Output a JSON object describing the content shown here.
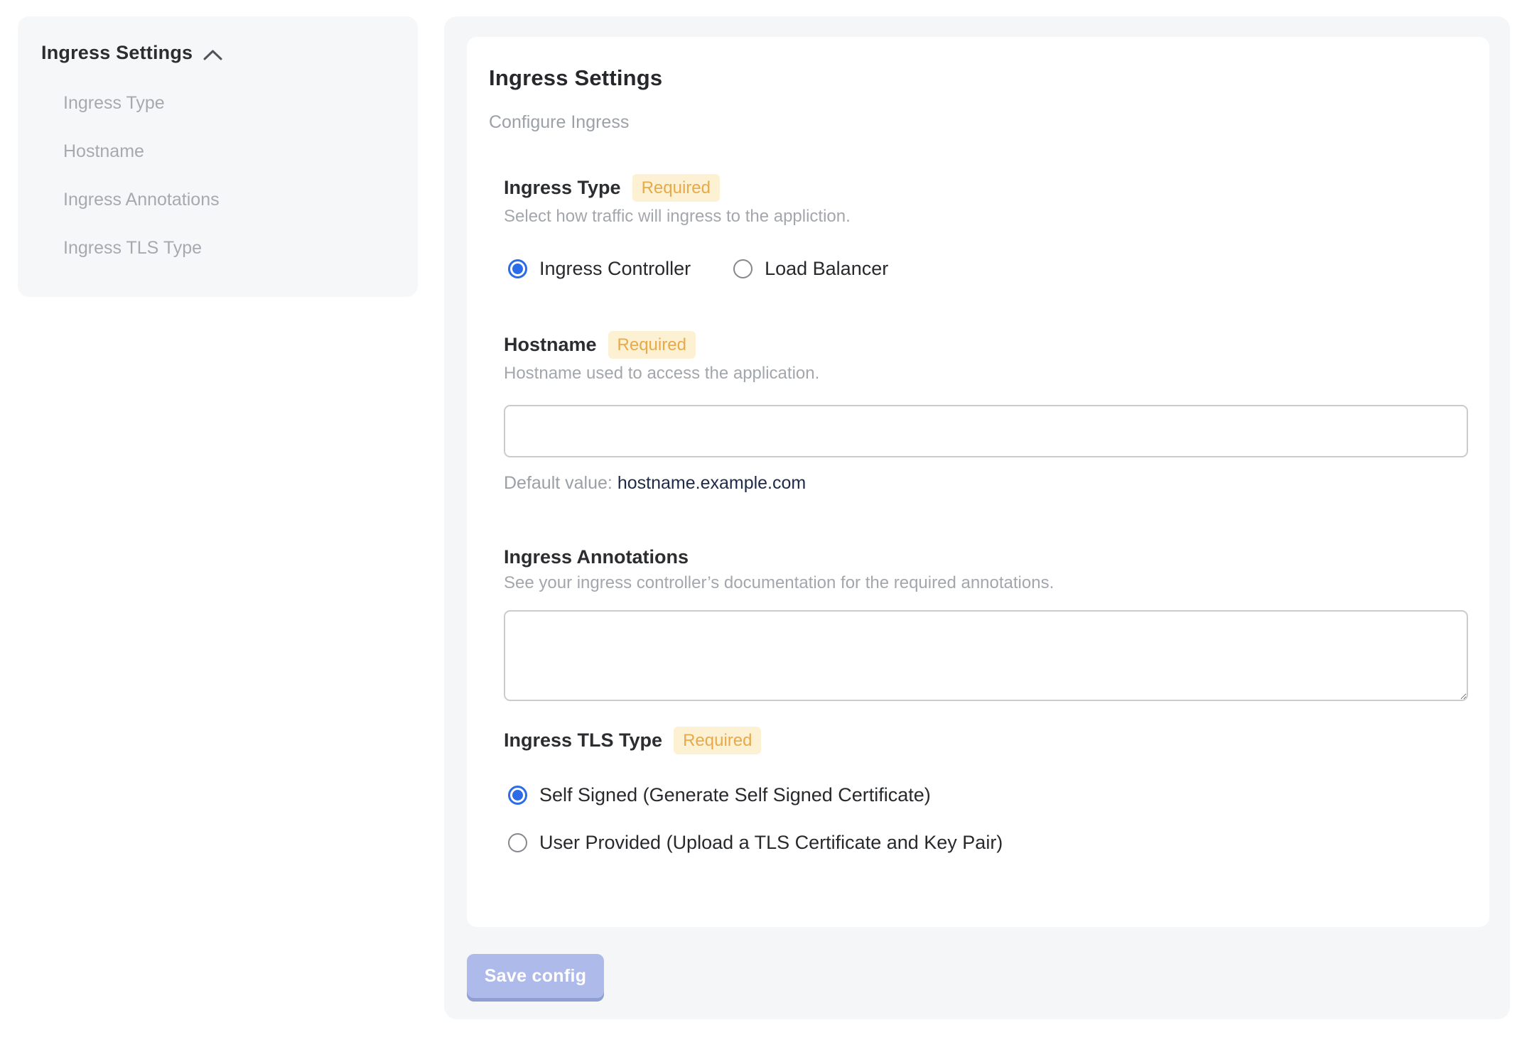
{
  "sidebar": {
    "title": "Ingress Settings",
    "collapse_icon": "chevron-up-icon",
    "items": [
      {
        "label": "Ingress Type"
      },
      {
        "label": "Hostname"
      },
      {
        "label": "Ingress Annotations"
      },
      {
        "label": "Ingress TLS Type"
      }
    ]
  },
  "main": {
    "title": "Ingress Settings",
    "subtitle": "Configure Ingress",
    "required_badge": "Required",
    "sections": {
      "ingress_type": {
        "label": "Ingress Type",
        "required": true,
        "description": "Select how traffic will ingress to the appliction.",
        "options": [
          {
            "label": "Ingress Controller",
            "selected": true
          },
          {
            "label": "Load Balancer",
            "selected": false
          }
        ]
      },
      "hostname": {
        "label": "Hostname",
        "required": true,
        "description": "Hostname used to access the application.",
        "value": "",
        "placeholder": "",
        "default_label": "Default value:",
        "default_value": "hostname.example.com"
      },
      "annotations": {
        "label": "Ingress Annotations",
        "required": false,
        "description": "See your ingress controller’s documentation for the required annotations.",
        "value": ""
      },
      "tls_type": {
        "label": "Ingress TLS Type",
        "required": true,
        "options": [
          {
            "label": "Self Signed (Generate Self Signed Certificate)",
            "selected": true
          },
          {
            "label": "User Provided (Upload a TLS Certificate and Key Pair)",
            "selected": false
          }
        ]
      }
    },
    "save_button": "Save config"
  },
  "colors": {
    "accent_blue": "#2c6ce8",
    "badge_bg": "#fcf2d3",
    "badge_text": "#e7a94a",
    "button_bg": "#adbaea",
    "button_shadow": "#8f9ed3",
    "panel_bg": "#f5f6f8",
    "sidebar_bg": "#f6f7f9",
    "default_value_text": "#1e2a47"
  }
}
